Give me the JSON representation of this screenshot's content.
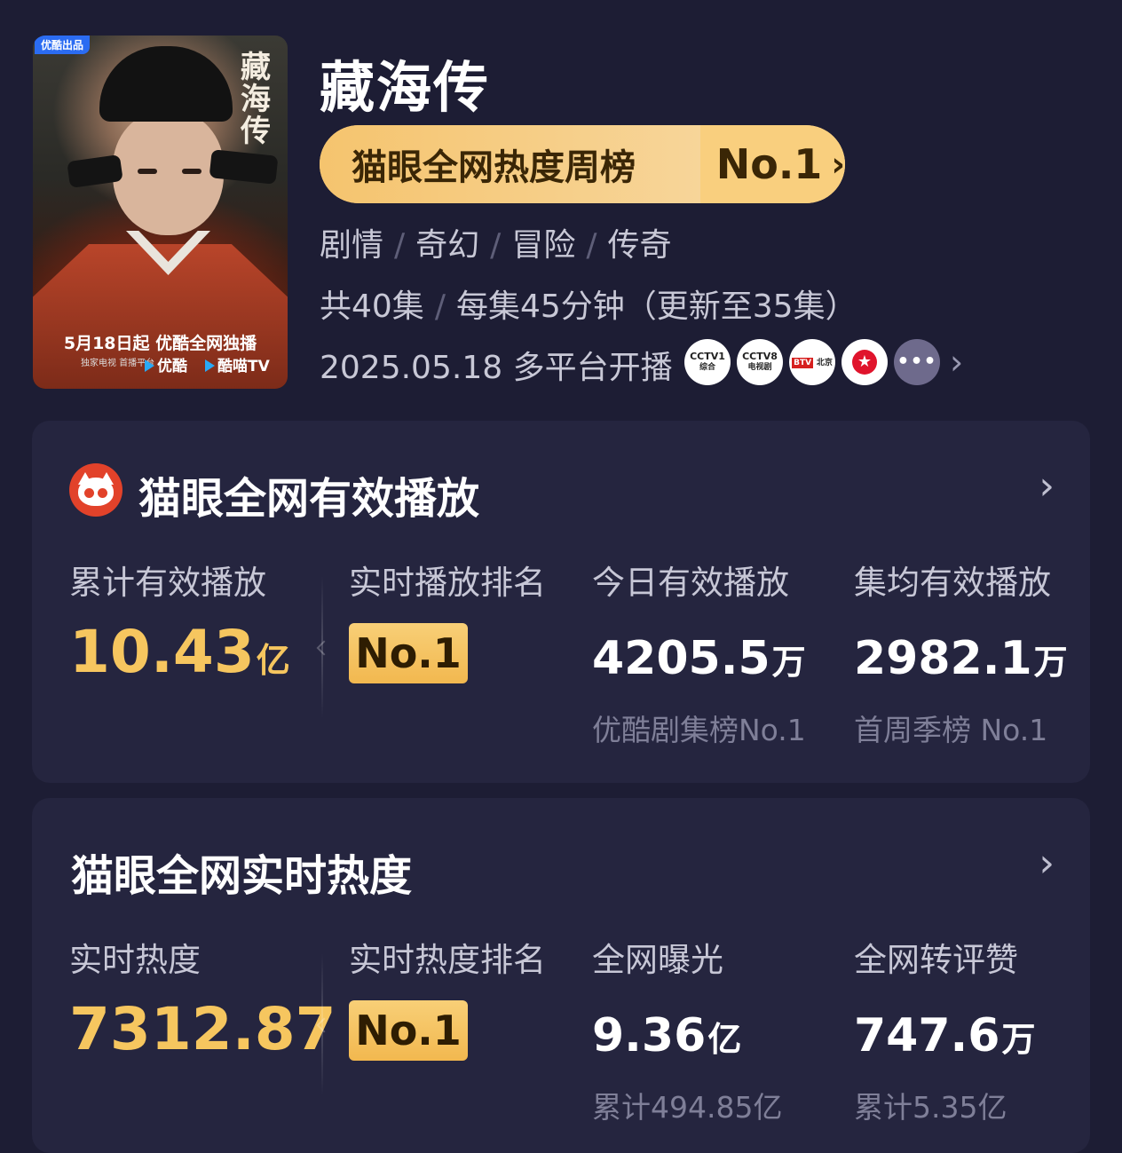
{
  "header": {
    "poster": {
      "badge": "优酷出品",
      "calligraphy": "藏海传",
      "release_line": "5月18日起 优酷全网独播",
      "platform_text": "独家电视 首播平台",
      "youku": "优酷",
      "kumiao": "酷喵TV"
    },
    "title": "藏海传",
    "ranking": {
      "label": "猫眼全网热度周榜",
      "value": "No.1",
      "chevron": "›"
    },
    "genres": [
      "剧情",
      "奇幻",
      "冒险",
      "传奇"
    ],
    "separator": "/",
    "episodes": {
      "count": "共40集",
      "duration": "每集45分钟（更新至35集）"
    },
    "release": {
      "text": "2025.05.18 多平台开播",
      "platforms": [
        {
          "name": "CCTV1",
          "sub": "综合"
        },
        {
          "name": "CCTV8",
          "sub": "电视剧"
        },
        {
          "name": "BTV",
          "sub": "北京"
        },
        {
          "name": "东方卫视",
          "icon": "star-icon"
        },
        {
          "name": "more",
          "icon": "more-icon",
          "label": "•••"
        }
      ],
      "chevron": "›"
    }
  },
  "playback_card": {
    "title": "猫眼全网有效播放",
    "chevron": "›",
    "stats": {
      "total": {
        "label": "累计有效播放",
        "value": "10.43",
        "unit": "亿"
      },
      "rank": {
        "label": "实时播放排名",
        "value": "No.1"
      },
      "today": {
        "label": "今日有效播放",
        "value": "4205.5",
        "unit": "万",
        "sub": "优酷剧集榜No.1"
      },
      "avg": {
        "label": "集均有效播放",
        "value": "2982.1",
        "unit": "万",
        "sub": "首周季榜 No.1"
      }
    }
  },
  "heat_card": {
    "title": "猫眼全网实时热度",
    "chevron": "›",
    "stats": {
      "heat": {
        "label": "实时热度",
        "value": "7312.87"
      },
      "rank": {
        "label": "实时热度排名",
        "value": "No.1"
      },
      "exposure": {
        "label": "全网曝光",
        "value": "9.36",
        "unit": "亿",
        "sub": "累计494.85亿"
      },
      "engagement": {
        "label": "全网转评赞",
        "value": "747.6",
        "unit": "万",
        "sub": "累计5.35亿"
      }
    }
  },
  "colors": {
    "background": "#1d1d34",
    "card": "#25253f",
    "gold": "#f6c65f",
    "accent_red": "#e2422a"
  }
}
